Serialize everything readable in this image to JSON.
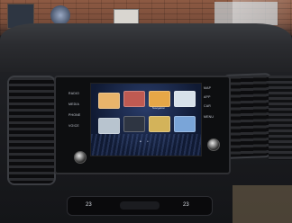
{
  "scene": {
    "brand_colors": {
      "screen_accent": "#2a3d6b",
      "panel": "#0d0e10"
    }
  },
  "left_buttons": [
    "RADIO",
    "MEDIA",
    "PHONE",
    "VOICE"
  ],
  "right_buttons": [
    "MAP",
    "APP",
    "CAR",
    "MENU"
  ],
  "home_tiles": [
    {
      "label": "",
      "color": "#e9b46b",
      "icon": "media-icon"
    },
    {
      "label": "",
      "color": "#bf5a52",
      "icon": "radio-icon"
    },
    {
      "label": "Navigation",
      "color": "#e6a747",
      "icon": "map-icon"
    },
    {
      "label": "",
      "color": "#d7e1ea",
      "icon": "phone-icon"
    },
    {
      "label": "",
      "color": "#b8c4cf",
      "icon": "weather-icon"
    },
    {
      "label": "",
      "color": "#2e3542",
      "icon": "tunnel-icon"
    },
    {
      "label": "",
      "color": "#d3b35a",
      "icon": "gallery-icon"
    },
    {
      "label": "",
      "color": "#7aa5d8",
      "icon": "sky-icon"
    }
  ],
  "page_dots": [
    "•",
    "•"
  ],
  "climate": {
    "left_temp": "23",
    "right_temp": "23"
  }
}
